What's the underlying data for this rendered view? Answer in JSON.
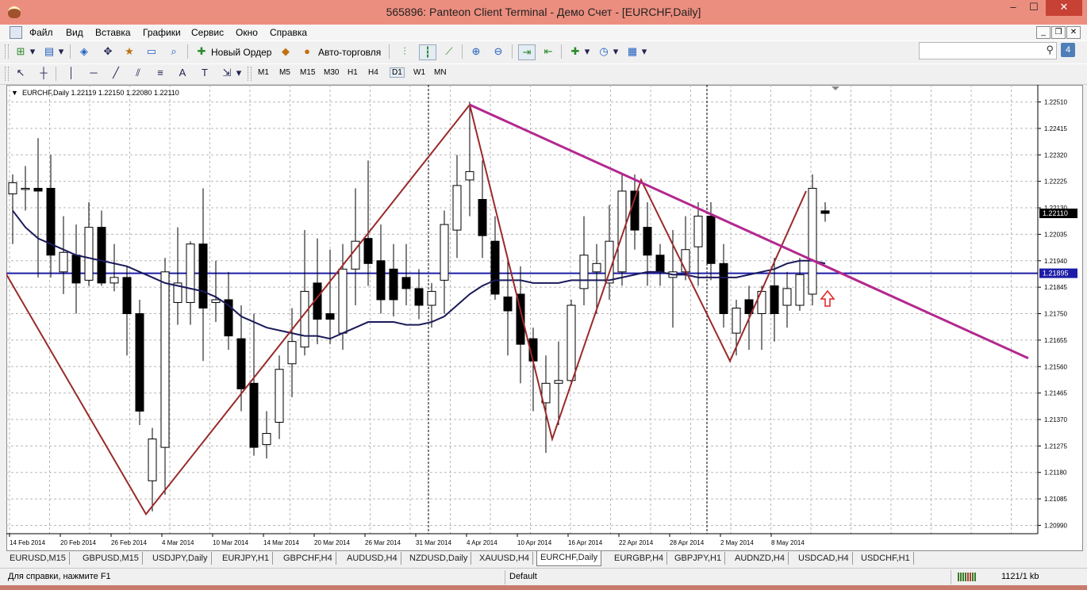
{
  "window": {
    "title": "565896: Panteon Client Terminal - Демо Счет - [EURCHF,Daily]",
    "minimize": "–",
    "maximize": "☐",
    "close": "✕"
  },
  "menu": [
    "Файл",
    "Вид",
    "Вставка",
    "Графики",
    "Сервис",
    "Окно",
    "Справка"
  ],
  "mdi": {
    "minimize": "_",
    "restore": "❐",
    "close": "✕"
  },
  "toolbar": {
    "new_order": "Новый Ордер",
    "autotrading": "Авто-торговля",
    "search_placeholder": "",
    "search_icon": "search-icon",
    "chat_label": "4"
  },
  "timeframes": [
    "M1",
    "M5",
    "M15",
    "M30",
    "H1",
    "H4",
    "D1",
    "W1",
    "MN"
  ],
  "active_timeframe": "D1",
  "chart": {
    "header": "EURCHF,Daily  1.22119 1.22150 1.22080 1.22110",
    "current_price": "1.22110",
    "hline_price": "1.21895"
  },
  "chart_data": {
    "type": "candlestick",
    "symbol": "EURCHF",
    "timeframe": "Daily",
    "ohlc_header": [
      1.22119,
      1.2215,
      1.2208,
      1.2211
    ],
    "y_ticks": [
      "1.22510",
      "1.22415",
      "1.22320",
      "1.22225",
      "1.22130",
      "1.22035",
      "1.21940",
      "1.21845",
      "1.21750",
      "1.21655",
      "1.21560",
      "1.21465",
      "1.21370",
      "1.21275",
      "1.21180",
      "1.21085",
      "1.20990"
    ],
    "ylim": [
      1.2096,
      1.2256
    ],
    "x_ticks": [
      "14 Feb 2014",
      "20 Feb 2014",
      "26 Feb 2014",
      "4 Mar 2014",
      "10 Mar 2014",
      "14 Mar 2014",
      "20 Mar 2014",
      "26 Mar 2014",
      "31 Mar 2014",
      "4 Apr 2014",
      "10 Apr 2014",
      "16 Apr 2014",
      "22 Apr 2014",
      "28 Apr 2014",
      "2 May 2014",
      "8 May 2014"
    ],
    "candles": [
      {
        "o": 1.2218,
        "h": 1.2225,
        "l": 1.22,
        "c": 1.2222
      },
      {
        "o": 1.222,
        "h": 1.2228,
        "l": 1.2212,
        "c": 1.222
      },
      {
        "o": 1.222,
        "h": 1.2238,
        "l": 1.2188,
        "c": 1.2219
      },
      {
        "o": 1.222,
        "h": 1.2232,
        "l": 1.2188,
        "c": 1.2196
      },
      {
        "o": 1.219,
        "h": 1.221,
        "l": 1.2182,
        "c": 1.2197
      },
      {
        "o": 1.2196,
        "h": 1.2207,
        "l": 1.2175,
        "c": 1.2186
      },
      {
        "o": 1.2187,
        "h": 1.2215,
        "l": 1.2185,
        "c": 1.2206
      },
      {
        "o": 1.2206,
        "h": 1.2212,
        "l": 1.2185,
        "c": 1.2186
      },
      {
        "o": 1.2186,
        "h": 1.22,
        "l": 1.2183,
        "c": 1.2188
      },
      {
        "o": 1.2188,
        "h": 1.2192,
        "l": 1.216,
        "c": 1.2175
      },
      {
        "o": 1.2175,
        "h": 1.218,
        "l": 1.2135,
        "c": 1.214
      },
      {
        "o": 1.2115,
        "h": 1.2134,
        "l": 1.2104,
        "c": 1.213
      },
      {
        "o": 1.2127,
        "h": 1.2195,
        "l": 1.211,
        "c": 1.219
      },
      {
        "o": 1.2179,
        "h": 1.2206,
        "l": 1.2171,
        "c": 1.2186
      },
      {
        "o": 1.2179,
        "h": 1.2201,
        "l": 1.2171,
        "c": 1.22
      },
      {
        "o": 1.22,
        "h": 1.222,
        "l": 1.2158,
        "c": 1.2177
      },
      {
        "o": 1.2179,
        "h": 1.2194,
        "l": 1.2172,
        "c": 1.218
      },
      {
        "o": 1.218,
        "h": 1.219,
        "l": 1.2162,
        "c": 1.2167
      },
      {
        "o": 1.2166,
        "h": 1.2178,
        "l": 1.214,
        "c": 1.2148
      },
      {
        "o": 1.215,
        "h": 1.2175,
        "l": 1.2124,
        "c": 1.2127
      },
      {
        "o": 1.2128,
        "h": 1.214,
        "l": 1.2123,
        "c": 1.2132
      },
      {
        "o": 1.2136,
        "h": 1.216,
        "l": 1.213,
        "c": 1.2155
      },
      {
        "o": 1.2157,
        "h": 1.2177,
        "l": 1.2145,
        "c": 1.2165
      },
      {
        "o": 1.2163,
        "h": 1.2205,
        "l": 1.216,
        "c": 1.2183
      },
      {
        "o": 1.2186,
        "h": 1.2202,
        "l": 1.2164,
        "c": 1.2173
      },
      {
        "o": 1.2175,
        "h": 1.2198,
        "l": 1.2164,
        "c": 1.2173
      },
      {
        "o": 1.2168,
        "h": 1.22,
        "l": 1.2162,
        "c": 1.2191
      },
      {
        "o": 1.2191,
        "h": 1.222,
        "l": 1.2178,
        "c": 1.2201
      },
      {
        "o": 1.2202,
        "h": 1.223,
        "l": 1.2185,
        "c": 1.2193
      },
      {
        "o": 1.2194,
        "h": 1.2207,
        "l": 1.2175,
        "c": 1.218
      },
      {
        "o": 1.2191,
        "h": 1.22,
        "l": 1.2174,
        "c": 1.218
      },
      {
        "o": 1.2188,
        "h": 1.22,
        "l": 1.2178,
        "c": 1.2184
      },
      {
        "o": 1.2184,
        "h": 1.2191,
        "l": 1.2173,
        "c": 1.2178
      },
      {
        "o": 1.2178,
        "h": 1.2186,
        "l": 1.217,
        "c": 1.2183
      },
      {
        "o": 1.2187,
        "h": 1.2212,
        "l": 1.2175,
        "c": 1.2207
      },
      {
        "o": 1.2205,
        "h": 1.2232,
        "l": 1.2195,
        "c": 1.2221
      },
      {
        "o": 1.2223,
        "h": 1.2251,
        "l": 1.221,
        "c": 1.2226
      },
      {
        "o": 1.2216,
        "h": 1.223,
        "l": 1.2195,
        "c": 1.2203
      },
      {
        "o": 1.2201,
        "h": 1.221,
        "l": 1.218,
        "c": 1.2182
      },
      {
        "o": 1.2181,
        "h": 1.2195,
        "l": 1.216,
        "c": 1.2176
      },
      {
        "o": 1.2182,
        "h": 1.2192,
        "l": 1.215,
        "c": 1.2164
      },
      {
        "o": 1.2166,
        "h": 1.217,
        "l": 1.214,
        "c": 1.2158
      },
      {
        "o": 1.2143,
        "h": 1.216,
        "l": 1.2125,
        "c": 1.215
      },
      {
        "o": 1.215,
        "h": 1.2165,
        "l": 1.2135,
        "c": 1.2151
      },
      {
        "o": 1.2151,
        "h": 1.218,
        "l": 1.215,
        "c": 1.2178
      },
      {
        "o": 1.2184,
        "h": 1.221,
        "l": 1.2178,
        "c": 1.2196
      },
      {
        "o": 1.219,
        "h": 1.22,
        "l": 1.2175,
        "c": 1.2193
      },
      {
        "o": 1.2186,
        "h": 1.2214,
        "l": 1.218,
        "c": 1.2201
      },
      {
        "o": 1.219,
        "h": 1.2225,
        "l": 1.2185,
        "c": 1.2219
      },
      {
        "o": 1.2219,
        "h": 1.2225,
        "l": 1.2198,
        "c": 1.2205
      },
      {
        "o": 1.2206,
        "h": 1.2215,
        "l": 1.2185,
        "c": 1.2196
      },
      {
        "o": 1.2196,
        "h": 1.22,
        "l": 1.2185,
        "c": 1.219
      },
      {
        "o": 1.2188,
        "h": 1.2205,
        "l": 1.217,
        "c": 1.219
      },
      {
        "o": 1.219,
        "h": 1.221,
        "l": 1.2187,
        "c": 1.2198
      },
      {
        "o": 1.2199,
        "h": 1.2215,
        "l": 1.2185,
        "c": 1.221
      },
      {
        "o": 1.221,
        "h": 1.2215,
        "l": 1.2187,
        "c": 1.2193
      },
      {
        "o": 1.2193,
        "h": 1.22,
        "l": 1.217,
        "c": 1.2175
      },
      {
        "o": 1.2168,
        "h": 1.218,
        "l": 1.216,
        "c": 1.2177
      },
      {
        "o": 1.218,
        "h": 1.2185,
        "l": 1.2162,
        "c": 1.2175
      },
      {
        "o": 1.2175,
        "h": 1.2185,
        "l": 1.2162,
        "c": 1.2183
      },
      {
        "o": 1.2185,
        "h": 1.2195,
        "l": 1.2165,
        "c": 1.2175
      },
      {
        "o": 1.2178,
        "h": 1.219,
        "l": 1.217,
        "c": 1.2184
      },
      {
        "o": 1.2178,
        "h": 1.2195,
        "l": 1.2176,
        "c": 1.2189
      },
      {
        "o": 1.2182,
        "h": 1.2225,
        "l": 1.2178,
        "c": 1.222
      },
      {
        "o": 1.22119,
        "h": 1.2215,
        "l": 1.2208,
        "c": 1.2211
      }
    ],
    "moving_average": [
      1.2212,
      1.2206,
      1.2202,
      1.22,
      1.2198,
      1.2196,
      1.2195,
      1.2194,
      1.2193,
      1.2192,
      1.219,
      1.2188,
      1.2186,
      1.2185,
      1.2184,
      1.2183,
      1.2181,
      1.2178,
      1.2174,
      1.2172,
      1.217,
      1.2169,
      1.2168,
      1.2167,
      1.2167,
      1.2166,
      1.2168,
      1.217,
      1.2172,
      1.2172,
      1.2172,
      1.2171,
      1.2171,
      1.2172,
      1.2174,
      1.2178,
      1.2182,
      1.2185,
      1.2187,
      1.2187,
      1.2187,
      1.2186,
      1.2186,
      1.2186,
      1.2187,
      1.2187,
      1.2187,
      1.2187,
      1.2188,
      1.2189,
      1.219,
      1.219,
      1.2189,
      1.2189,
      1.2188,
      1.2188,
      1.2188,
      1.2188,
      1.2189,
      1.219,
      1.2191,
      1.2193,
      1.2194,
      1.2194,
      1.2193
    ],
    "zigzag": [
      [
        -1,
        1.2193
      ],
      [
        10.5,
        1.2103
      ],
      [
        36,
        1.225
      ],
      [
        42.5,
        1.213
      ],
      [
        49.5,
        1.2223
      ],
      [
        56.5,
        1.2158
      ],
      [
        62.5,
        1.2219
      ]
    ],
    "trendline": [
      [
        36,
        1.225
      ],
      [
        80,
        1.2159
      ]
    ],
    "hline": 1.21895
  },
  "symbol_tabs": [
    "EURUSD,M15",
    "GBPUSD,M15",
    "USDJPY,Daily",
    "EURJPY,H1",
    "GBPCHF,H4",
    "AUDUSD,H4",
    "NZDUSD,Daily",
    "XAUUSD,H4",
    "EURCHF,Daily",
    "EURGBP,H4",
    "GBPJPY,H1",
    "AUDNZD,H4",
    "USDCAD,H4",
    "USDCHF,H1"
  ],
  "active_tab": "EURCHF,Daily",
  "status": {
    "help": "Для справки, нажмите F1",
    "profile": "Default",
    "traffic": "1121/1 kb"
  }
}
